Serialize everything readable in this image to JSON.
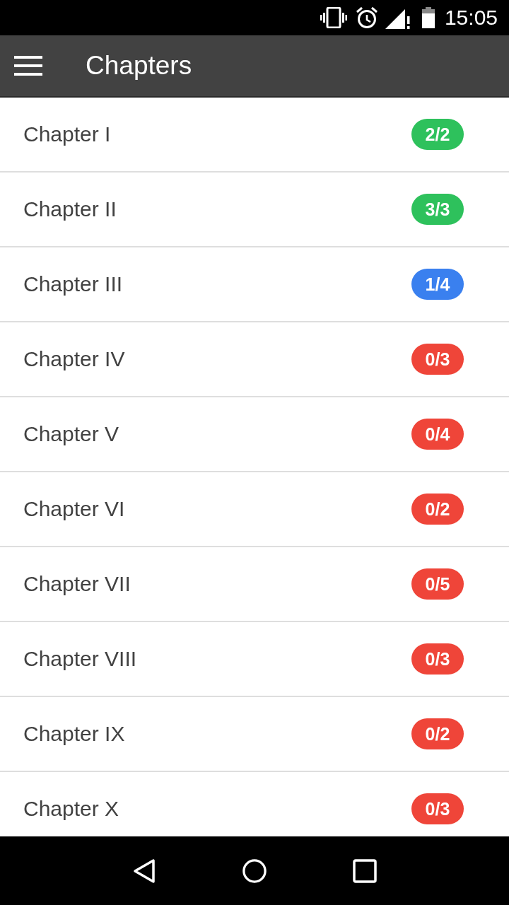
{
  "status_bar": {
    "time": "15:05"
  },
  "app_bar": {
    "title": "Chapters"
  },
  "chapters": [
    {
      "title": "Chapter I",
      "progress": "2/2",
      "color": "#2ec15c"
    },
    {
      "title": "Chapter II",
      "progress": "3/3",
      "color": "#2ec15c"
    },
    {
      "title": "Chapter III",
      "progress": "1/4",
      "color": "#3a80ef"
    },
    {
      "title": "Chapter IV",
      "progress": "0/3",
      "color": "#ef4539"
    },
    {
      "title": "Chapter V",
      "progress": "0/4",
      "color": "#ef4539"
    },
    {
      "title": "Chapter VI",
      "progress": "0/2",
      "color": "#ef4539"
    },
    {
      "title": "Chapter VII",
      "progress": "0/5",
      "color": "#ef4539"
    },
    {
      "title": "Chapter VIII",
      "progress": "0/3",
      "color": "#ef4539"
    },
    {
      "title": "Chapter IX",
      "progress": "0/2",
      "color": "#ef4539"
    },
    {
      "title": "Chapter X",
      "progress": "0/3",
      "color": "#ef4539"
    }
  ]
}
